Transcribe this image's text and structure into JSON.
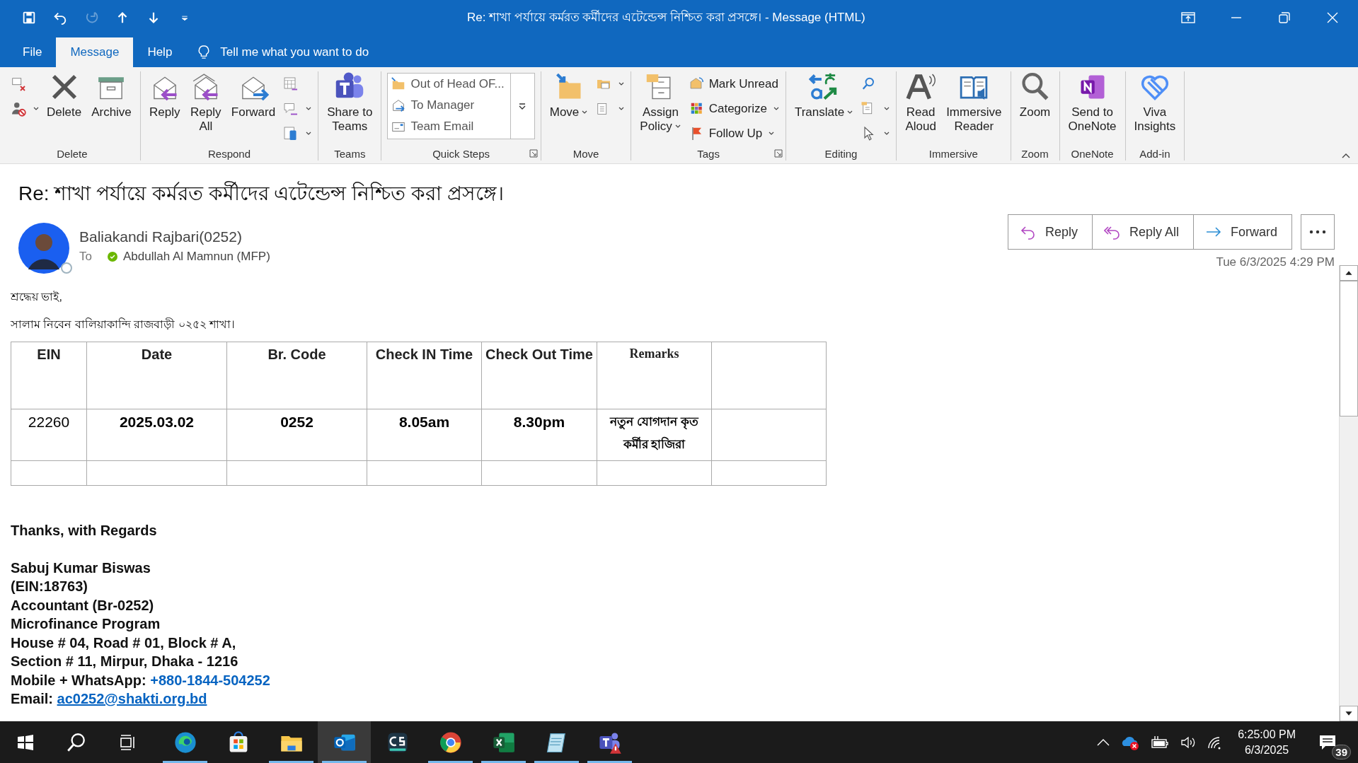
{
  "quick_access": [
    {
      "disabled": false
    },
    {
      "disabled": false
    },
    {
      "disabled": true
    },
    {
      "disabled": false
    },
    {
      "disabled": false
    },
    {
      "disabled": false
    }
  ],
  "window": {
    "title": "Re: শাখা পর্যায়ে কর্মরত কর্মীদের এটেন্ডেন্স নিশ্চিত করা প্রসঙ্গে।  -  Message (HTML)"
  },
  "menu_tabs": [
    {
      "label": "File",
      "selected": false
    },
    {
      "label": "Message",
      "selected": true
    },
    {
      "label": "Help",
      "selected": false
    }
  ],
  "tell_me": {
    "placeholder": "Tell me what you want to do"
  },
  "ribbon": {
    "groups": [
      {
        "name": "Delete",
        "launcher": false,
        "columns": [
          {
            "kind": "stack",
            "items": [
              {
                "dropdown": false
              },
              {
                "dropdown": true
              }
            ]
          },
          {
            "kind": "large",
            "label": "Delete",
            "dropdown": false
          },
          {
            "kind": "large",
            "label": "Archive",
            "dropdown": false
          }
        ]
      },
      {
        "name": "Respond",
        "launcher": false,
        "columns": [
          {
            "kind": "large",
            "label": "Reply",
            "dropdown": false
          },
          {
            "kind": "large",
            "label": "Reply\nAll",
            "dropdown": false
          },
          {
            "kind": "large",
            "label": "Forward",
            "dropdown": false
          },
          {
            "kind": "stack",
            "items": [
              {
                "dropdown": false
              },
              {
                "dropdown": true
              },
              {
                "dropdown": true
              }
            ]
          }
        ]
      },
      {
        "name": "Teams",
        "launcher": false,
        "columns": [
          {
            "kind": "large",
            "label": "Share to\nTeams",
            "dropdown": false
          }
        ]
      },
      {
        "name": "Quick Steps",
        "launcher": true,
        "columns": [
          {
            "kind": "gallery",
            "items": [
              {
                "label": "Out of Head OF..."
              },
              {
                "label": "To Manager"
              },
              {
                "label": "Team Email"
              }
            ]
          }
        ]
      },
      {
        "name": "Move",
        "launcher": false,
        "columns": [
          {
            "kind": "large",
            "label": "Move",
            "dropdown": true
          },
          {
            "kind": "stack",
            "items": [
              {
                "dropdown": true
              },
              {
                "dropdown": true
              }
            ]
          }
        ]
      },
      {
        "name": "Tags",
        "launcher": true,
        "columns": [
          {
            "kind": "large",
            "label": "Assign\nPolicy",
            "dropdown": true
          },
          {
            "kind": "stack",
            "items": [
              {
                "label": "Mark Unread",
                "dropdown": false
              },
              {
                "label": "Categorize",
                "dropdown": true
              },
              {
                "label": "Follow Up",
                "dropdown": true
              }
            ]
          }
        ]
      },
      {
        "name": "Editing",
        "launcher": false,
        "columns": [
          {
            "kind": "large",
            "label": "Translate",
            "dropdown": true
          },
          {
            "kind": "stack",
            "items": [
              {
                "dropdown": false
              },
              {
                "dropdown": true
              },
              {
                "dropdown": true
              }
            ]
          }
        ]
      },
      {
        "name": "Immersive",
        "launcher": false,
        "columns": [
          {
            "kind": "large",
            "label": "Read\nAloud",
            "dropdown": false
          },
          {
            "kind": "large",
            "label": "Immersive\nReader",
            "dropdown": false
          }
        ]
      },
      {
        "name": "Zoom",
        "launcher": false,
        "columns": [
          {
            "kind": "large",
            "label": "Zoom",
            "dropdown": false
          }
        ]
      },
      {
        "name": "OneNote",
        "launcher": false,
        "columns": [
          {
            "kind": "large",
            "label": "Send to\nOneNote",
            "dropdown": false
          }
        ]
      },
      {
        "name": "Add-in",
        "launcher": false,
        "columns": [
          {
            "kind": "large",
            "label": "Viva\nInsights",
            "dropdown": false
          }
        ]
      }
    ]
  },
  "message": {
    "subject": "Re: শাখা পর্যায়ে কর্মরত কর্মীদের এটেন্ডেন্স নিশ্চিত করা প্রসঙ্গে।",
    "sender": "Baliakandi Rajbari(0252)",
    "to_label": "To",
    "recipient": "Abdullah Al Mamnun (MFP)",
    "date": "Tue 6/3/2025 4:29 PM",
    "actions": [
      {
        "label": "Reply"
      },
      {
        "label": "Reply All"
      },
      {
        "label": "Forward"
      }
    ]
  },
  "body": {
    "greeting": "শ্রদ্ধেয় ভাই,",
    "intro": "সালাম নিবেন বালিয়াকান্দি রাজবাড়ী ০২৫২ শাখা।",
    "table": {
      "columns": [
        "EIN",
        "Date",
        "Br. Code",
        "Check IN Time",
        "Check Out Time",
        "Remarks"
      ],
      "rows": [
        [
          "22260",
          "2025.03.02",
          "0252",
          "8.05am",
          "8.30pm",
          "নতুন যোগদান কৃত কর্মীর হাজিরা"
        ]
      ]
    },
    "closing": "Thanks, with Regards",
    "signature": [
      "Sabuj  Kumar Biswas",
      "(EIN:18763)",
      "Accountant (Br-0252)",
      "Microfinance Program",
      "House # 04, Road # 01, Block # A,",
      "Section # 11, Mirpur, Dhaka - 1216"
    ],
    "phone": {
      "label": "Mobile + WhatsApp:",
      "link": "+880-1844-504252"
    },
    "email": {
      "label": "Email:",
      "link": "ac0252@shakti.org.bd"
    }
  },
  "taskbar": {
    "apps": [
      {
        "running": true,
        "selected": false
      },
      {
        "running": false,
        "selected": false
      },
      {
        "running": true,
        "selected": false
      },
      {
        "running": true,
        "selected": true
      },
      {
        "running": false,
        "selected": false
      },
      {
        "running": true,
        "selected": false
      },
      {
        "running": true,
        "selected": false
      },
      {
        "running": true,
        "selected": false
      },
      {
        "running": true,
        "selected": false
      }
    ],
    "time": "6:25:00 PM",
    "date": "6/3/2025",
    "notifications": "39"
  }
}
